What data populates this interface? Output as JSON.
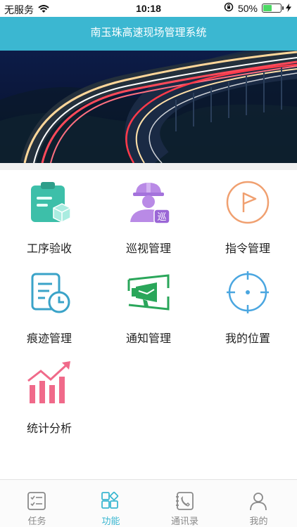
{
  "status_bar": {
    "carrier": "无服务",
    "time": "10:18",
    "battery_percent": "50%",
    "battery_level": 0.5
  },
  "header": {
    "title": "南玉珠高速现场管理系统"
  },
  "banner": {
    "slide_count": 4,
    "active_slide": 1
  },
  "functions": [
    {
      "label": "工序验收",
      "icon": "clipboard-box-icon",
      "color": "#3dbfa9"
    },
    {
      "label": "巡视管理",
      "icon": "inspector-icon",
      "color": "#b98ae6"
    },
    {
      "label": "指令管理",
      "icon": "flag-icon",
      "color": "#f0a070"
    },
    {
      "label": "痕迹管理",
      "icon": "document-clock-icon",
      "color": "#3aa3c8"
    },
    {
      "label": "通知管理",
      "icon": "megaphone-icon",
      "color": "#2aa65a"
    },
    {
      "label": "我的位置",
      "icon": "location-target-icon",
      "color": "#4aa6e0"
    },
    {
      "label": "统计分析",
      "icon": "bar-chart-icon",
      "color": "#f06a8a"
    }
  ],
  "tabs": [
    {
      "label": "任务",
      "icon": "task-list-icon",
      "active": false
    },
    {
      "label": "功能",
      "icon": "grid-icon",
      "active": true
    },
    {
      "label": "通讯录",
      "icon": "contacts-icon",
      "active": false
    },
    {
      "label": "我的",
      "icon": "user-icon",
      "active": false
    }
  ],
  "colors": {
    "accent": "#3bb7d1",
    "inactive": "#8a8a8a",
    "indicator_active": "#e8322a"
  }
}
